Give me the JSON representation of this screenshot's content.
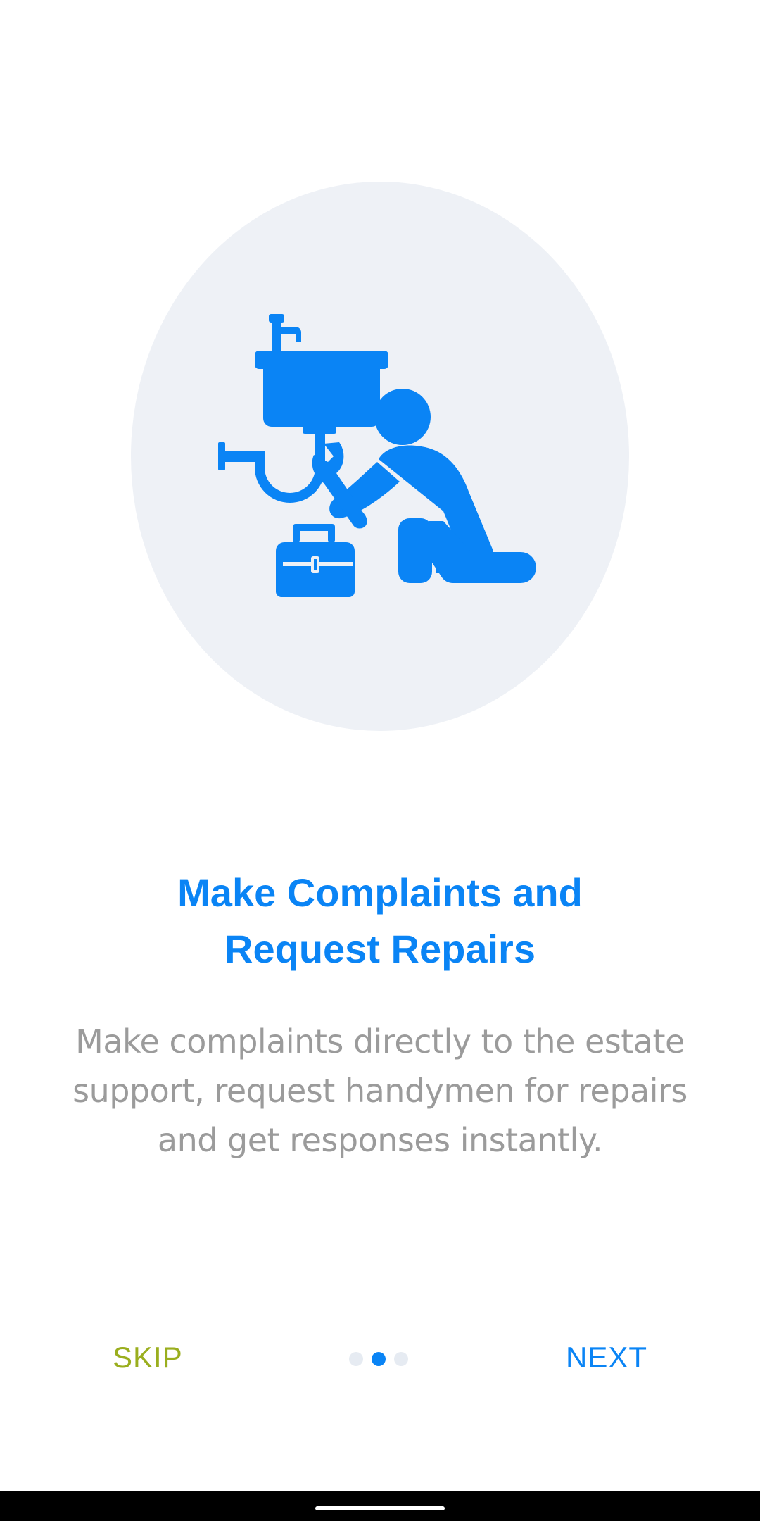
{
  "onboarding": {
    "title_line1": "Make Complaints and",
    "title_line2": "Request Repairs",
    "description_line1": "Make complaints directly to the estate",
    "description_line2": "support, request handymen for repairs",
    "description_line3": "and get responses instantly.",
    "illustration_icon": "plumber-repair-icon",
    "skip_label": "SKIP",
    "next_label": "NEXT",
    "page_indicator": {
      "total": 3,
      "active_index": 1
    }
  },
  "colors": {
    "accent": "#0a84f5",
    "skip": "#9aae1e",
    "circle_bg": "#eef1f6",
    "description_text": "#9b9b9b"
  }
}
